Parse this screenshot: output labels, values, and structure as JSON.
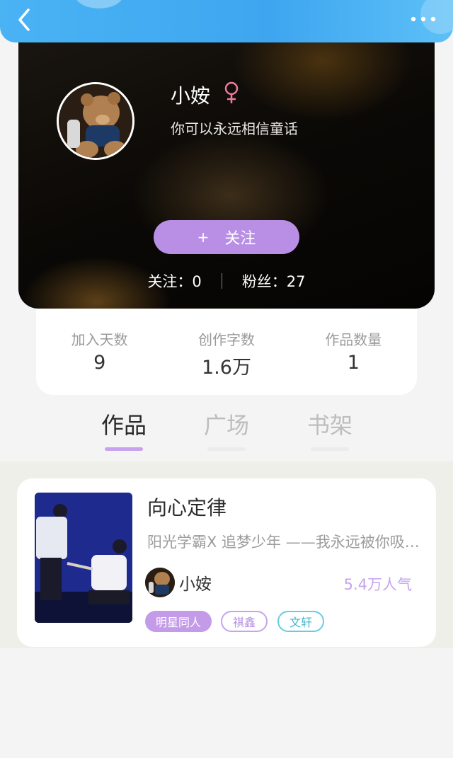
{
  "nav": {
    "back_icon": "chevron-left-icon",
    "more_icon": "more-dots-icon"
  },
  "profile": {
    "name": "小姲",
    "gender_icon": "female-symbol-icon",
    "bio": "你可以永远相信童话",
    "follow_plus": "+",
    "follow_label": "关注",
    "following_text": "关注：0",
    "fans_text": "粉丝：27"
  },
  "stats": [
    {
      "label": "加入天数",
      "value": "9"
    },
    {
      "label": "创作字数",
      "value": "1.6万"
    },
    {
      "label": "作品数量",
      "value": "1"
    }
  ],
  "tabs": [
    {
      "label": "作品",
      "active": true
    },
    {
      "label": "广场",
      "active": false
    },
    {
      "label": "书架",
      "active": false
    }
  ],
  "works": [
    {
      "title": "向心定律",
      "description": "阳光学霸X  追梦少年  ——我永远被你吸…",
      "author": "小姲",
      "popularity": "5.4万人气",
      "tags": [
        "明星同人",
        "祺鑫",
        "文轩"
      ]
    }
  ],
  "colors": {
    "accent_purple": "#b98fe6",
    "top_bar_blue": "#3ea6f0",
    "tag_cyan": "#66cde0"
  }
}
